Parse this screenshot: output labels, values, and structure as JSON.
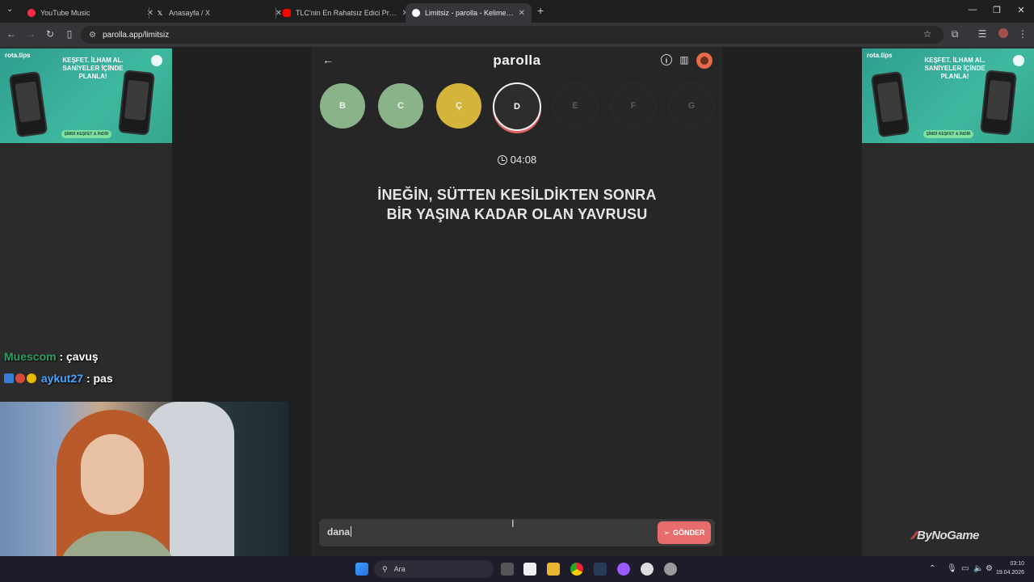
{
  "browser": {
    "tabs": [
      {
        "title": "YouTube Music",
        "favicon": "youtube-music-icon",
        "color": "#ff2a4a"
      },
      {
        "title": "Anasayfa / X",
        "favicon": "x-logo-icon",
        "color": "#ffffff"
      },
      {
        "title": "TLC'nin En Rahatsız Edici Progr...",
        "favicon": "youtube-icon",
        "color": "#ff0000"
      },
      {
        "title": "Limitsiz - parolla - Kelime oyunu",
        "favicon": "parolla-icon",
        "color": "#ffffff",
        "active": true
      }
    ],
    "new_tab_label": "+",
    "url": "parolla.app/limitsiz"
  },
  "ads": {
    "brand": "rota.tips",
    "headline": "KEŞFET. İLHAM AL. SANİYELER İÇİNDE PLANLA!",
    "cta": "ŞİMDİ KEŞFET & İNDİR"
  },
  "chat": [
    {
      "user": "Muescom",
      "message": ": çavuş"
    },
    {
      "user": "aykut27",
      "message": ": pas"
    }
  ],
  "game": {
    "logo": "parolla",
    "letters": [
      {
        "letter": "B",
        "state": "correct"
      },
      {
        "letter": "C",
        "state": "correct"
      },
      {
        "letter": "Ç",
        "state": "pass"
      },
      {
        "letter": "D",
        "state": "current"
      },
      {
        "letter": "E",
        "state": "empty"
      },
      {
        "letter": "F",
        "state": "empty"
      },
      {
        "letter": "G",
        "state": "empty"
      }
    ],
    "timer": "04:08",
    "question_line1": "İNEĞİN, SÜTTEN KESİLDİKTEN SONRA",
    "question_line2": "BİR YAŞINA KADAR OLAN YAVRUSU",
    "answer_value": "dana",
    "send_label": "GÖNDER"
  },
  "watermark": "ByNoGame",
  "taskbar": {
    "search_placeholder": "Ara",
    "time": "03:10",
    "date": "19.04.2026"
  }
}
